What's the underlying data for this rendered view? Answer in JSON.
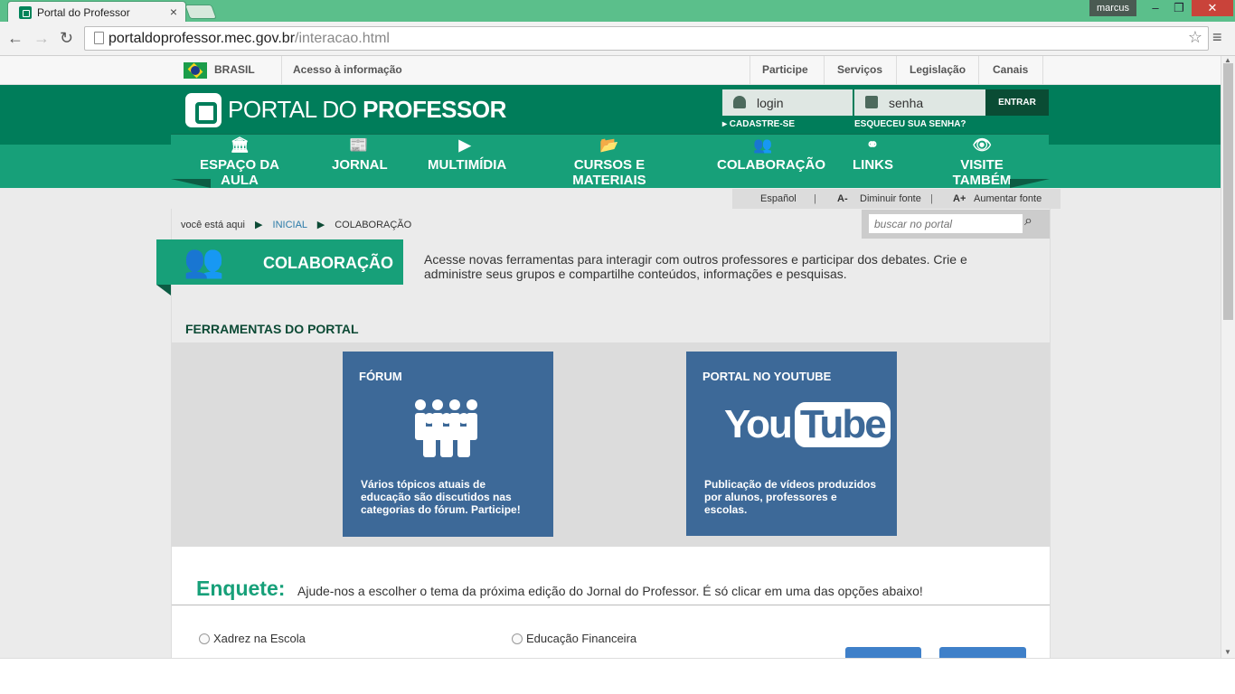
{
  "browser": {
    "tab_title": "Portal do Professor",
    "tab_close": "×",
    "user": "marcus",
    "url_host": "portaldoprofessor.mec.gov.br",
    "url_path": "/interacao.html"
  },
  "govbar": {
    "country": "BRASIL",
    "access_info": "Acesso à informação",
    "links": [
      "Participe",
      "Serviços",
      "Legislação",
      "Canais"
    ]
  },
  "header": {
    "logo_text_light": "PORTAL DO ",
    "logo_text_bold": "PROFESSOR",
    "login_placeholder": "login",
    "password_placeholder": "senha",
    "enter_label": "ENTRAR",
    "register_label": "▸ CADASTRE-SE",
    "forgot_label": "ESQUECEU SUA SENHA?"
  },
  "menu": [
    {
      "label": "ESPAÇO DA AULA",
      "icon": "museum-icon"
    },
    {
      "label": "JORNAL",
      "icon": "newspaper-icon"
    },
    {
      "label": "MULTIMÍDIA",
      "icon": "play-icon"
    },
    {
      "label": "CURSOS E MATERIAIS",
      "icon": "folder-icon"
    },
    {
      "label": "COLABORAÇÃO",
      "icon": "people-icon"
    },
    {
      "label": "LINKS",
      "icon": "link-icon"
    },
    {
      "label": "VISITE TAMBÉM",
      "icon": "eye-icon"
    }
  ],
  "accessibility": {
    "espanol": "Español",
    "decrease": "Diminuir fonte",
    "increase": "Aumentar fonte",
    "a_minus": "A-",
    "a_plus": "A+"
  },
  "breadcrumb": {
    "prefix": "você está aqui",
    "home": "INICIAL",
    "current": "COLABORAÇÃO"
  },
  "search": {
    "placeholder": "buscar no portal"
  },
  "section": {
    "title": "COLABORAÇÃO",
    "intro": "Acesse novas ferramentas para interagir com outros professores e participar dos debates. Crie e administre seus grupos e compartilhe conteúdos, informações e pesquisas."
  },
  "tools": {
    "title": "FERRAMENTAS DO PORTAL",
    "forum": {
      "title": "FÓRUM",
      "desc": "Vários tópicos atuais de educação são discutidos nas categorias do fórum. Participe!"
    },
    "youtube": {
      "title": "PORTAL NO YOUTUBE",
      "logo_you": "You",
      "logo_tube": "Tube",
      "desc": "Publicação de vídeos produzidos por alunos, professores e escolas."
    }
  },
  "poll": {
    "title": "Enquete:",
    "question": "Ajude-nos a escolher o tema da próxima edição do Jornal do Professor. É só clicar em uma das opções abaixo!",
    "options": [
      "Xadrez na Escola",
      "Educação Financeira"
    ]
  }
}
